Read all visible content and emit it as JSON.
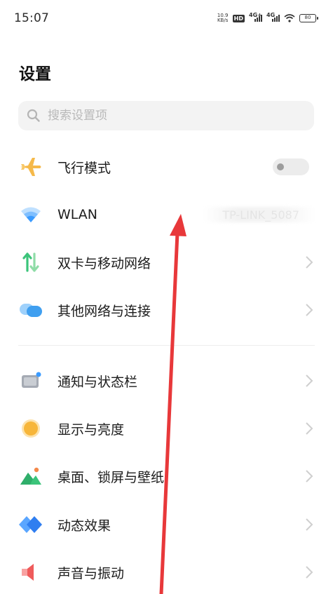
{
  "status_bar": {
    "time": "15:07",
    "net_speed": "10.9\nKB/s",
    "hd_badge": "HD",
    "signal_1_label": "4G+",
    "signal_2_label": "4G",
    "battery_level": "80"
  },
  "page_title": "设置",
  "search": {
    "placeholder": "搜索设置项"
  },
  "group_network": [
    {
      "label": "飞行模式",
      "icon": "airplane-icon",
      "control": "toggle",
      "toggle_on": false
    },
    {
      "label": "WLAN",
      "icon": "wifi-icon",
      "value": "TP-LINK_5087"
    },
    {
      "label": "双卡与移动网络",
      "icon": "sim-data-icon"
    },
    {
      "label": "其他网络与连接",
      "icon": "cloud-link-icon"
    }
  ],
  "group_system": [
    {
      "label": "通知与状态栏",
      "icon": "notification-icon"
    },
    {
      "label": "显示与亮度",
      "icon": "brightness-icon"
    },
    {
      "label": "桌面、锁屏与壁纸",
      "icon": "wallpaper-icon"
    },
    {
      "label": "动态效果",
      "icon": "animation-icon"
    },
    {
      "label": "声音与振动",
      "icon": "speaker-icon"
    }
  ],
  "colors": {
    "airplane": "#f5b94a",
    "wifi": "#3b9bff",
    "sim_green": "#3bc47a",
    "cloud": "#4aa8f5",
    "brightness": "#f7b63a",
    "annotation_arrow": "#e8383a"
  }
}
